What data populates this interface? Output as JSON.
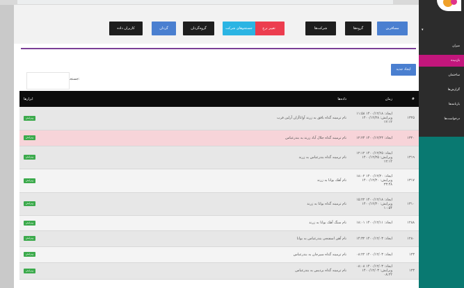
{
  "toolbar": {
    "buttons": [
      {
        "label": "مسافرين",
        "style": "blue"
      },
      {
        "label": "گروه‌ها",
        "style": "dark"
      },
      {
        "label": "شركت‌ها",
        "style": "dark"
      },
      {
        "label": "تغيير نرخ",
        "style": "red"
      },
      {
        "label": "جستجوهاى شركت",
        "style": "cyan"
      },
      {
        "label": "گروه‌گردان",
        "style": "dark"
      },
      {
        "label": "گردان",
        "style": "blue"
      },
      {
        "label": "كاربران داده",
        "style": "dark"
      }
    ]
  },
  "new_button_label": "ايجاد جديد",
  "search": {
    "label": "جستجو:"
  },
  "table": {
    "headers": {
      "id": "#",
      "time": "زمان",
      "data": "داده‌ها",
      "tools": "ابزارها"
    },
    "edit_label": "ويرايش",
    "rows": [
      {
        "id": "۱۳۲۵",
        "time1": "ايجاد: ۱۴۰۰/۱۲/۱۸ ۱۱:۵۸",
        "time2": "ويرايش: ۱۴۰۰/۱۲/۲۸ ۱۲:۱۲",
        "data": "نام ترمينه گذاه بافق به زرند آوانا‌آزان آرلين فرب",
        "pink": false
      },
      {
        "id": "۱۳۲۰",
        "time1": "ايجاد: ۱۴۰۰/۱۲/۲۴ ۱۲:۲۴",
        "time2": "",
        "data": "نام ترمينه گذاه جلال آباد زرند به بندرعباس",
        "pink": true
      },
      {
        "id": "۱۳۱۹",
        "time1": "ايجاد: ۱۴۰۰/۱۲/۲۵ ۱۲:۱۲",
        "time2": "ويرايش: ۱۴۰۰/۱۲/۲۵ ۱۲:۱۲",
        "data": "نام ترمينه گذاه بندرعباس به زرند",
        "pink": false
      },
      {
        "id": "۱۳۱۷",
        "time1": "ايجاد: ۱۴۰۰/۱۲/۲۰ ۱۸:۰۲",
        "time2": "ويرايش: ۱۴۰۰/۱۲/۲۰ ۲۳:۴۸",
        "data": "نام آهک بوانا به زرند",
        "pink": false
      },
      {
        "id": "۱۳۱۰",
        "time1": "ايجاد: ۱۴۰۰/۱۲/۱۸ ۱۵:۲۲",
        "time2": "ويرايش: ۱۴۰۰/۱۲/۲۰ ۱۰:۵۴",
        "data": "نام ترمينه گذاه بوانا به زرند",
        "pink": false
      },
      {
        "id": "۱۲۸۸",
        "time1": "ايجاد: ۱۴۰۰/۱۲/۱۱ ۱۸:۰۱",
        "time2": "",
        "data": "نام سنگ آهک بوانا به زرند",
        "pink": false
      },
      {
        "id": "۱۲۸۰",
        "time1": "ايجاد: ۱۴۰۰/۱۲/۰۳ ۱۴:۳۲",
        "time2": "",
        "data": "نام آهن اسفنجی بندرعباس به بوانا",
        "pink": false
      },
      {
        "id": "۱۲۳",
        "time1": "ايجاد: ۱۴۰۰/۱۲/۰۳ ۰۸:۲۲",
        "time2": "",
        "data": "نام ترمينه گذاه سيرجان به بندرعباس",
        "pink": false
      },
      {
        "id": "۱۲۳",
        "time1": "ايجاد: ۱۴۰۰/۱۲/۰۳ ۰۸:۰۸",
        "time2": "ويرايش: ۱۴۰۰/۱۲/۰۳ ۰۸:۲۲",
        "data": "نام ترمينه گذاه برديس به بندرعباس",
        "pink": false
      }
    ]
  },
  "sidebar": {
    "items": [
      {
        "label": "ميزان",
        "active": false
      },
      {
        "label": "بازدیده",
        "active": true
      },
      {
        "label": "ساختمان",
        "active": false
      },
      {
        "label": "گزارش‌ها",
        "active": false
      },
      {
        "label": "بارنامه‌ها",
        "active": false
      },
      {
        "label": "درخواست‌ها",
        "active": false
      }
    ]
  },
  "colors": {
    "accent": "#7a3e96",
    "sidebar": "#097971",
    "active": "#c2167c",
    "edit": "#3caa4c"
  }
}
